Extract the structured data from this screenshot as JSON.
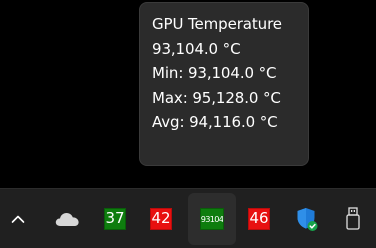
{
  "tooltip": {
    "title": "GPU Temperature",
    "current": "93,104.0 °C",
    "min": "Min: 93,104.0 °C",
    "max": "Max: 95,128.0 °C",
    "avg": "Avg: 94,116.0 °C"
  },
  "tray": {
    "chevron_icon": "chevron-up-icon",
    "cloud_icon": "onedrive-cloud-icon",
    "temp_green": {
      "value": "37",
      "color": "#0e7d0e"
    },
    "temp_red": {
      "value": "42",
      "color": "#e81010"
    },
    "gpu_temp": {
      "value": "93104",
      "color": "#0e7d0e"
    },
    "temp_red2": {
      "value": "46",
      "color": "#e81010"
    },
    "defender_icon": "windows-security-shield-icon",
    "usb_icon": "usb-drive-icon"
  }
}
